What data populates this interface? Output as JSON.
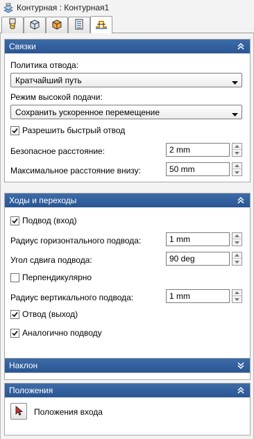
{
  "window": {
    "title": "Контурная : Контурная1"
  },
  "tabs": [
    {
      "icon": "tool-icon"
    },
    {
      "icon": "holder-icon"
    },
    {
      "icon": "stock-icon"
    },
    {
      "icon": "heights-icon"
    },
    {
      "icon": "linking-icon",
      "active": true
    }
  ],
  "links": {
    "title": "Связки",
    "retract_policy_label": "Политика отвода:",
    "retract_policy_value": "Кратчайший путь",
    "high_feed_label": "Режим высокой подачи:",
    "high_feed_value": "Сохранить ускоренное перемещение",
    "allow_rapid_retract": {
      "label": "Разрешить быстрый отвод",
      "checked": true
    },
    "safe_distance_label": "Безопасное расстояние:",
    "safe_distance_value": "2 mm",
    "max_stay_down_label": "Максимальное расстояние внизу:",
    "max_stay_down_value": "50 mm"
  },
  "leads": {
    "title": "Ходы и переходы",
    "lead_in": {
      "label": "Подвод (вход)",
      "checked": true
    },
    "horiz_radius_label": "Радиус горизонтального подвода:",
    "horiz_radius_value": "1 mm",
    "sweep_angle_label": "Угол сдвига подвода:",
    "sweep_angle_value": "90 deg",
    "perpendicular": {
      "label": "Перпендикулярно",
      "checked": false
    },
    "vert_radius_label": "Радиус вертикального подвода:",
    "vert_radius_value": "1 mm",
    "lead_out": {
      "label": "Отвод (выход)",
      "checked": true
    },
    "same_as_lead_in": {
      "label": "Аналогично подводу",
      "checked": true
    }
  },
  "ramp": {
    "title": "Наклон"
  },
  "positions": {
    "title": "Положения",
    "entry_positions_label": "Положения входа"
  },
  "colors": {
    "header": "#2f5d9a",
    "check": "#1a1a1a"
  }
}
